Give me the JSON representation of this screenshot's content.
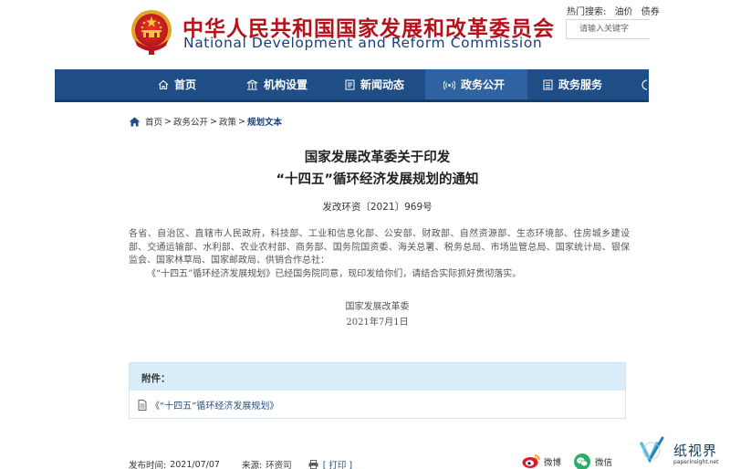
{
  "header": {
    "title_cn": "中华人民共和国国家发展和改革委员会",
    "title_en": "National Development and Reform Commission",
    "hot_search_label": "热门搜索:",
    "hot_search_links": [
      "油价",
      "债券"
    ],
    "search_placeholder": "请输入关键字"
  },
  "nav": {
    "items": [
      {
        "label": "首页",
        "icon": "home-icon"
      },
      {
        "label": "机构设置",
        "icon": "building-icon"
      },
      {
        "label": "新闻动态",
        "icon": "news-icon"
      },
      {
        "label": "政务公开",
        "icon": "broadcast-icon",
        "active": true
      },
      {
        "label": "政务服务",
        "icon": "service-icon"
      }
    ],
    "bg_color": "#1f4e86",
    "active_color": "#2f62a0"
  },
  "breadcrumb": {
    "items": [
      "首页",
      "政务公开",
      "政策",
      "规划文本"
    ],
    "separator": ">"
  },
  "article": {
    "title_line1": "国家发展改革委关于印发",
    "title_line2": "“十四五”循环经济发展规划的通知",
    "doc_number": "发改环资〔2021〕969号",
    "paragraph1": "各省、自治区、直辖市人民政府，科技部、工业和信息化部、公安部、财政部、自然资源部、生态环境部、住房城乡建设部、交通运输部、水利部、农业农村部、商务部、国务院国资委、海关总署、税务总局、市场监管总局、国家统计局、银保监会、国家林草局、国家邮政局、供销合作总社：",
    "paragraph2": "《“十四五”循环经济发展规划》已经国务院同意，现印发给你们，请结合实际抓好贯彻落实。",
    "signature_org": "国家发展改革委",
    "signature_date": "2021年7月1日"
  },
  "attachment": {
    "heading": "附件：",
    "link": "《“十四五”循环经济发展规划》"
  },
  "footer": {
    "publish_label": "发布时间:",
    "publish_date": "2021/07/07",
    "source_label": "来源:",
    "source": "环资司",
    "print_label": "[ 打印 ]",
    "share_weibo": "微博",
    "share_wechat": "微信"
  },
  "watermark": {
    "name": "纸视界",
    "url": "paperinsight.net"
  }
}
